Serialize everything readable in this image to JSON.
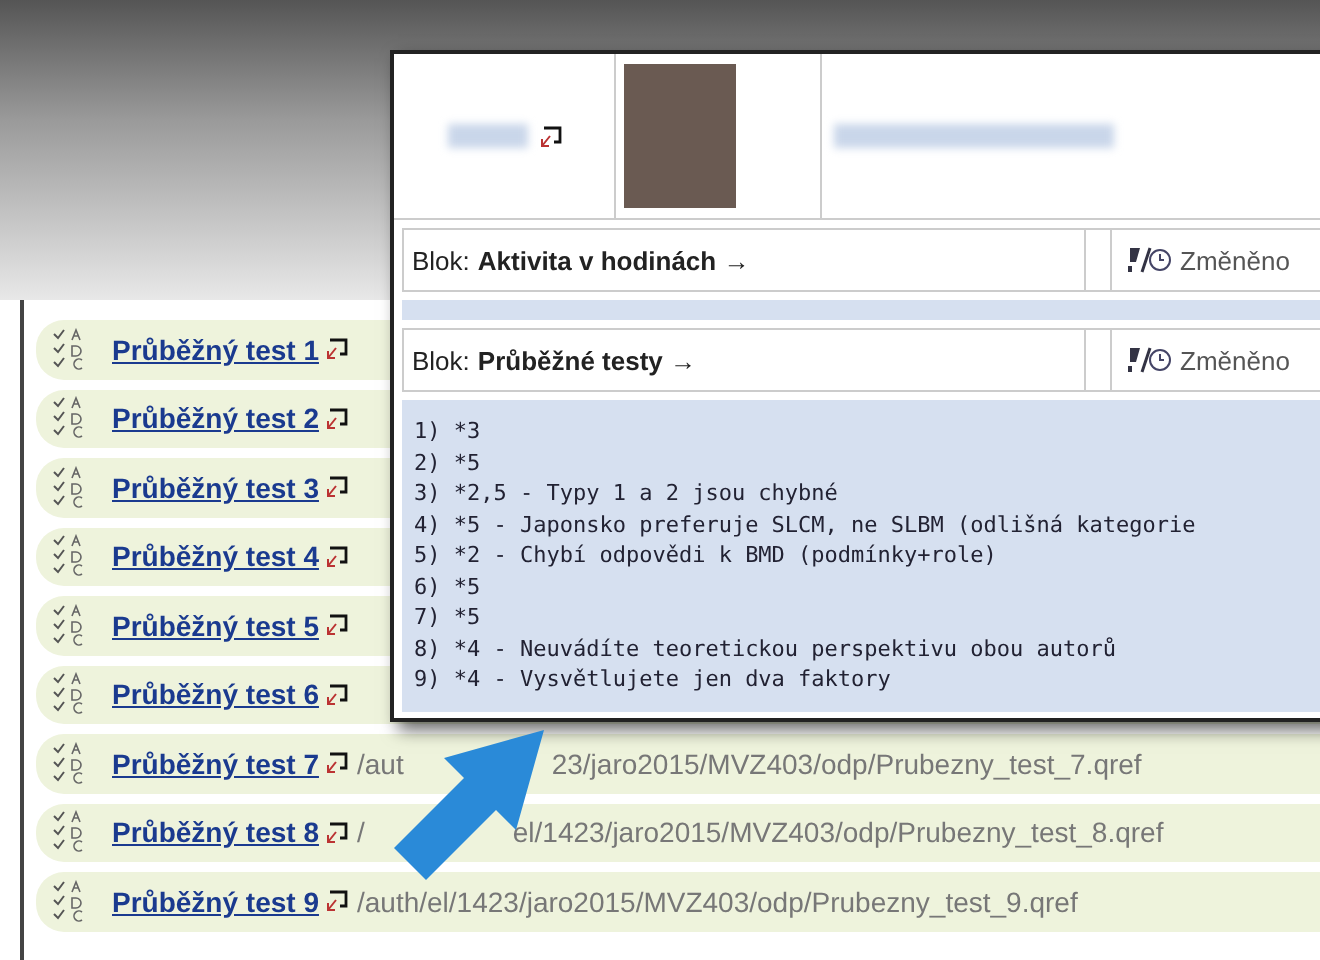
{
  "tests": [
    {
      "title": "Průběžný test 1"
    },
    {
      "title": "Průběžný test 2"
    },
    {
      "title": "Průběžný test 3"
    },
    {
      "title": "Průběžný test 4"
    },
    {
      "title": "Průběžný test 5"
    },
    {
      "title": "Průběžný test 6"
    },
    {
      "title": "Průběžný test 7",
      "path_parts": [
        "/aut",
        "23/jaro2015/MVZ403/odp/Prubezny_test_7.qref"
      ]
    },
    {
      "title": "Průběžný test 8",
      "path_parts": [
        "/",
        "el/1423/jaro2015/MVZ403/odp/Prubezny_test_8.qref"
      ]
    },
    {
      "title": "Průběžný test 9",
      "path_parts": [
        "/auth/el/1423/jaro2015/MVZ403/odp/Prubezny_test_9.qref"
      ]
    }
  ],
  "popup": {
    "blocks": [
      {
        "label": "Blok:",
        "name": "Aktivita v hodinách →",
        "changed": "Změněno"
      },
      {
        "label": "Blok:",
        "name": "Průběžné testy →",
        "changed": "Změněno",
        "lines": [
          "1) *3",
          "2) *5",
          "3) *2,5 - Typy 1 a 2 jsou chybné",
          "4) *5 - Japonsko preferuje SLCM, ne SLBM (odlišná kategorie",
          "5) *2 - Chybí odpovědi k BMD (podmínky+role)",
          "6) *5",
          "7) *5",
          "8) *4 - Neuvádíte teoretickou perspektivu obou autorů",
          "9) *4 - Vysvětlujete jen dva faktory"
        ]
      }
    ]
  }
}
